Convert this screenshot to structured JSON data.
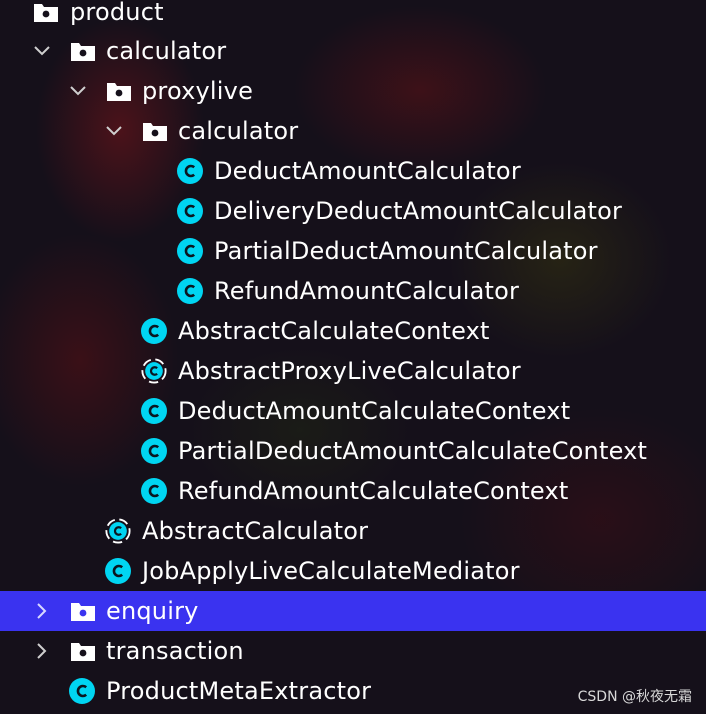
{
  "colors": {
    "background": "#15101a",
    "selection": "#3a33f0",
    "class_icon": "#00d5f2",
    "text": "#ffffff"
  },
  "tree": {
    "items": [
      {
        "label": "product",
        "icon": "folder-icon"
      },
      {
        "label": "calculator",
        "icon": "folder-icon",
        "state": "expanded"
      },
      {
        "label": "proxylive",
        "icon": "folder-icon",
        "state": "expanded"
      },
      {
        "label": "calculator",
        "icon": "folder-icon",
        "state": "expanded"
      },
      {
        "label": "DeductAmountCalculator",
        "icon": "class-icon"
      },
      {
        "label": "DeliveryDeductAmountCalculator",
        "icon": "class-icon"
      },
      {
        "label": "PartialDeductAmountCalculator",
        "icon": "class-icon"
      },
      {
        "label": "RefundAmountCalculator",
        "icon": "class-icon"
      },
      {
        "label": "AbstractCalculateContext",
        "icon": "class-icon"
      },
      {
        "label": "AbstractProxyLiveCalculator",
        "icon": "abstract-class-icon"
      },
      {
        "label": "DeductAmountCalculateContext",
        "icon": "class-icon"
      },
      {
        "label": "PartialDeductAmountCalculateContext",
        "icon": "class-icon"
      },
      {
        "label": "RefundAmountCalculateContext",
        "icon": "class-icon"
      },
      {
        "label": "AbstractCalculator",
        "icon": "abstract-class-icon"
      },
      {
        "label": "JobApplyLiveCalculateMediator",
        "icon": "class-icon"
      },
      {
        "label": "enquiry",
        "icon": "folder-icon",
        "state": "collapsed",
        "selected": true
      },
      {
        "label": "transaction",
        "icon": "folder-icon",
        "state": "collapsed"
      },
      {
        "label": "ProductMetaExtractor",
        "icon": "class-icon"
      }
    ]
  },
  "watermark": "CSDN @秋夜无霜"
}
